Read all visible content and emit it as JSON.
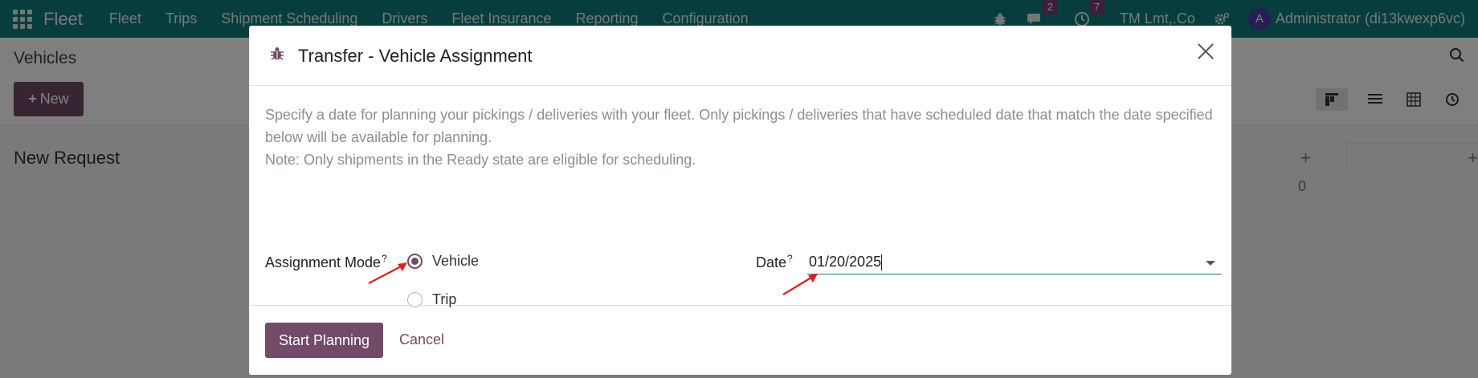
{
  "navbar": {
    "brand": "Fleet",
    "menu": [
      "Fleet",
      "Trips",
      "Shipment Scheduling",
      "Drivers",
      "Fleet Insurance",
      "Reporting",
      "Configuration"
    ],
    "messages_count": "2",
    "activities_count": "7",
    "company": "TM Lmt,.Co",
    "avatar_letter": "A",
    "user": "Administrator (di13kwexp6vc)"
  },
  "control_panel": {
    "breadcrumb": "Vehicles",
    "new_button": "New",
    "new_icon": "+"
  },
  "kanban": {
    "column_title": "New Request",
    "column_count": "0"
  },
  "modal": {
    "title": "Transfer - Vehicle Assignment",
    "help_line1": "Specify a date for planning your pickings / deliveries with your fleet. Only pickings / deliveries that have scheduled date that match the date specified below will be available for planning.",
    "help_line2": "Note: Only shipments in the Ready state are eligible for scheduling.",
    "assignment_mode_label": "Assignment Mode",
    "help_marker": "?",
    "options": [
      {
        "label": "Vehicle",
        "checked": true
      },
      {
        "label": "Trip",
        "checked": false
      }
    ],
    "date_label": "Date",
    "date_value": "01/20/2025",
    "start_button": "Start Planning",
    "cancel_button": "Cancel"
  },
  "colors": {
    "navbar": "#0f7c7a",
    "primary": "#714b67",
    "annotation_arrow": "#e02020"
  }
}
